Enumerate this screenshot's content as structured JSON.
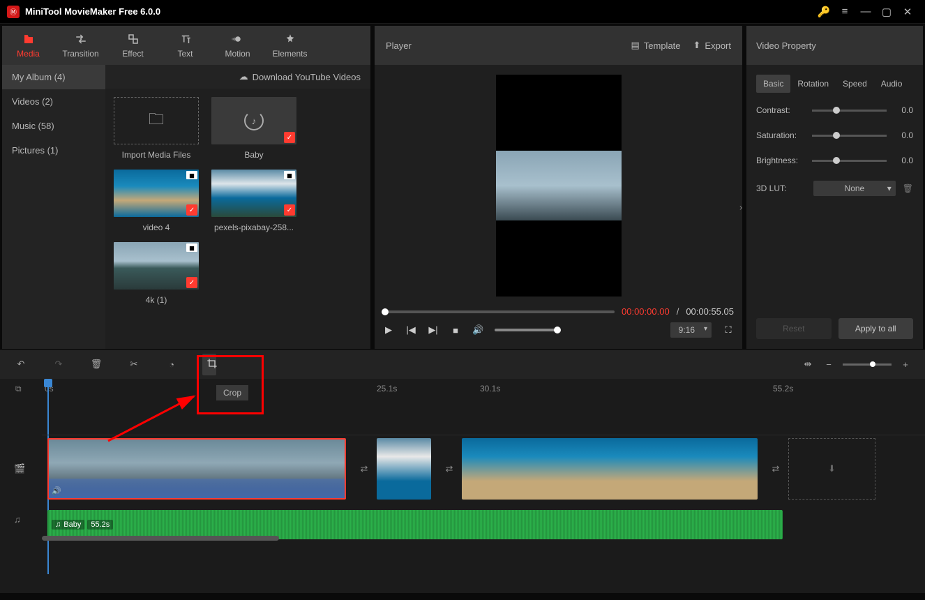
{
  "app": {
    "title": "MiniTool MovieMaker Free 6.0.0"
  },
  "tabs": {
    "media": "Media",
    "transition": "Transition",
    "effect": "Effect",
    "text": "Text",
    "motion": "Motion",
    "elements": "Elements"
  },
  "sidebar": {
    "items": [
      "My Album (4)",
      "Videos (2)",
      "Music (58)",
      "Pictures (1)"
    ]
  },
  "dlbar": "Download YouTube Videos",
  "media_items": {
    "import": "Import Media Files",
    "baby": "Baby",
    "video4": "video 4",
    "pexels": "pexels-pixabay-258...",
    "fourk": "4k (1)"
  },
  "player": {
    "title": "Player",
    "template": "Template",
    "export": "Export",
    "cur": "00:00:00.00",
    "sep": " / ",
    "tot": "00:00:55.05",
    "aspect": "9:16"
  },
  "prop": {
    "title": "Video Property",
    "tabs": {
      "basic": "Basic",
      "rotation": "Rotation",
      "speed": "Speed",
      "audio": "Audio"
    },
    "contrast_lbl": "Contrast:",
    "contrast_val": "0.0",
    "saturation_lbl": "Saturation:",
    "saturation_val": "0.0",
    "brightness_lbl": "Brightness:",
    "brightness_val": "0.0",
    "lut_lbl": "3D LUT:",
    "lut_val": "None",
    "reset": "Reset",
    "apply": "Apply to all"
  },
  "timeline": {
    "crop_tooltip": "Crop",
    "ruler": [
      "0s",
      "25.1s",
      "30.1s",
      "55.2s"
    ],
    "audio_name": "Baby",
    "audio_dur": "55.2s"
  }
}
